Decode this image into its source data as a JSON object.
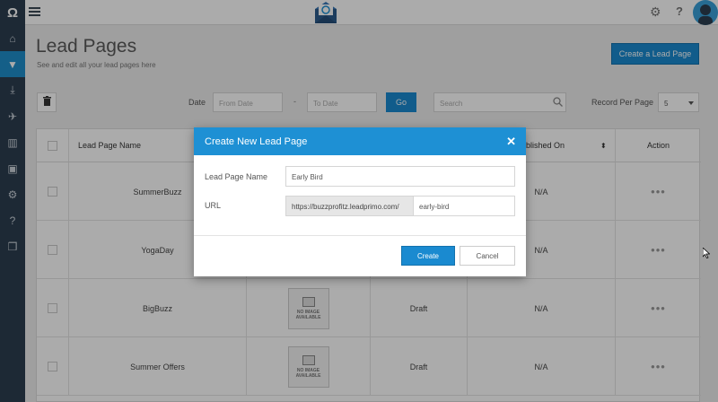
{
  "topbar": {
    "logo_letter": "Ω",
    "help_glyph": "?"
  },
  "sidebar": {
    "items": [
      {
        "icon": "home-icon",
        "glyph": "⌂"
      },
      {
        "icon": "funnel-icon",
        "glyph": "▼",
        "active": true
      },
      {
        "icon": "download-icon",
        "glyph": "⤓"
      },
      {
        "icon": "paper-plane-icon",
        "glyph": "✈"
      },
      {
        "icon": "bar-chart-icon",
        "glyph": "▥"
      },
      {
        "icon": "image-icon",
        "glyph": "▣"
      },
      {
        "icon": "cogs-icon",
        "glyph": "⚙"
      },
      {
        "icon": "question-icon",
        "glyph": "?"
      },
      {
        "icon": "gift-icon",
        "glyph": "❒"
      }
    ]
  },
  "header": {
    "title": "Lead Pages",
    "subtitle": "See and edit all your lead pages here",
    "create_button": "Create a Lead Page"
  },
  "filters": {
    "date_label": "Date",
    "from_placeholder": "From Date",
    "dash": "-",
    "to_placeholder": "To Date",
    "go_label": "Go",
    "search_placeholder": "Search",
    "rpp_label": "Record Per Page",
    "rpp_value": "5"
  },
  "table": {
    "columns": [
      "Lead Page Name",
      "ublished On",
      "Action"
    ],
    "sort_glyph": "⬍",
    "rows": [
      {
        "name": "SummerBuzz",
        "status": "",
        "published": "N/A",
        "action": "•••",
        "has_image": false
      },
      {
        "name": "YogaDay",
        "status": "",
        "published": "N/A",
        "action": "•••",
        "has_image": false
      },
      {
        "name": "BigBuzz",
        "status": "Draft",
        "published": "N/A",
        "action": "•••",
        "has_image": true
      },
      {
        "name": "Summer Offers",
        "status": "Draft",
        "published": "N/A",
        "action": "•••",
        "has_image": true
      }
    ],
    "no_image_text": "NO IMAGE AVAILABLE"
  },
  "modal": {
    "title": "Create New Lead Page",
    "close_glyph": "✕",
    "name_label": "Lead Page Name",
    "name_value": "Early Bird",
    "url_label": "URL",
    "url_prefix": "https://buzzprofitz.leadprimo.com/",
    "url_slug": "early-bird",
    "create_label": "Create",
    "cancel_label": "Cancel"
  }
}
